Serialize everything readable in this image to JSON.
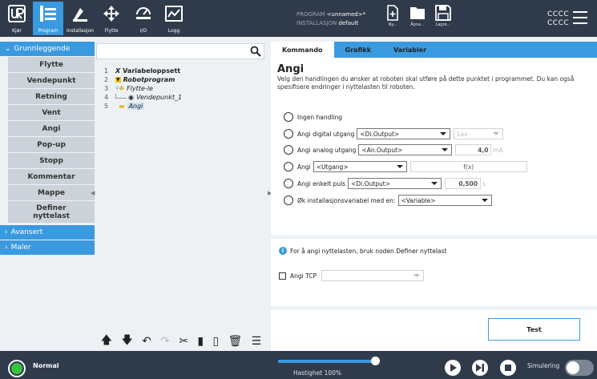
{
  "topbar": {
    "nav": [
      {
        "name": "run",
        "label": "Kjør"
      },
      {
        "name": "program",
        "label": "Program"
      },
      {
        "name": "installation",
        "label": "Installasjon"
      },
      {
        "name": "move",
        "label": "Flytte"
      },
      {
        "name": "io",
        "label": "I/O"
      },
      {
        "name": "log",
        "label": "Logg"
      }
    ],
    "program_key": "PROGRAM",
    "program_val": "<unnamed>*",
    "install_key": "INSTALLASJON",
    "install_val": "default",
    "new_label": "Ny...",
    "open_label": "Åpne...",
    "save_label": "Lagre...",
    "cccc_line1": "CCCC",
    "cccc_line2": "CCCC"
  },
  "sidebar": {
    "basic": "Grunnleggende",
    "nodes": [
      "Flytte",
      "Vendepunkt",
      "Retning",
      "Vent",
      "Angi",
      "Pop-up",
      "Stopp",
      "Kommentar",
      "Mappe"
    ],
    "define_payload_1": "Definer",
    "define_payload_2": "nyttelast",
    "advanced": "Avansert",
    "templates": "Maler"
  },
  "tree": {
    "lines": [
      {
        "num": "1",
        "icon": "X",
        "text": "Variabeloppsett"
      },
      {
        "num": "2",
        "icon": "▼",
        "text": "Robotprogram"
      },
      {
        "num": "3",
        "icon": "✥",
        "text": "Flytte-le"
      },
      {
        "num": "4",
        "icon": "◉",
        "text": "Vendepunkt_1"
      },
      {
        "num": "5",
        "icon": "▬",
        "text": "Angi"
      }
    ]
  },
  "panel": {
    "tabs": [
      "Kommando",
      "Grafikk",
      "Variabler"
    ],
    "title": "Angi",
    "description": "Velg den handlingen du ønsker at roboten skal utføre på dette punktet i programmet. Du kan også spesifisere endringer i nyttelasten til roboten.",
    "opt_none": "Ingen handling",
    "opt_digital": "Angi digital utgang",
    "digital_sel": "<Di.Output>",
    "digital_val": "Lav",
    "opt_analog": "Angi analog utgang",
    "analog_sel": "<An.Output>",
    "analog_val": "4,0",
    "analog_unit": "mA",
    "opt_set": "Angi",
    "set_sel": "<Utgang>",
    "set_fx": "f(x)",
    "opt_pulse": "Angi enkelt puls",
    "pulse_sel": "<Di.Output>",
    "pulse_val": "0,500",
    "pulse_unit": "s",
    "opt_increase": "Øk installasjonsvariabel med en:",
    "increase_sel": "<Variable>",
    "info_text": "For å angi nyttelasten, bruk noden Definer nyttelast",
    "tcp_label": "Angi TCP",
    "test_label": "Test"
  },
  "bottombar": {
    "status": "Normal",
    "speed_pct": 100,
    "speed_label": "Hastighet 100%",
    "sim_label": "Simulering"
  },
  "colors": {
    "accent": "#3a9ae0",
    "bar": "#2f3a4a",
    "status_ok": "#36c43c"
  }
}
